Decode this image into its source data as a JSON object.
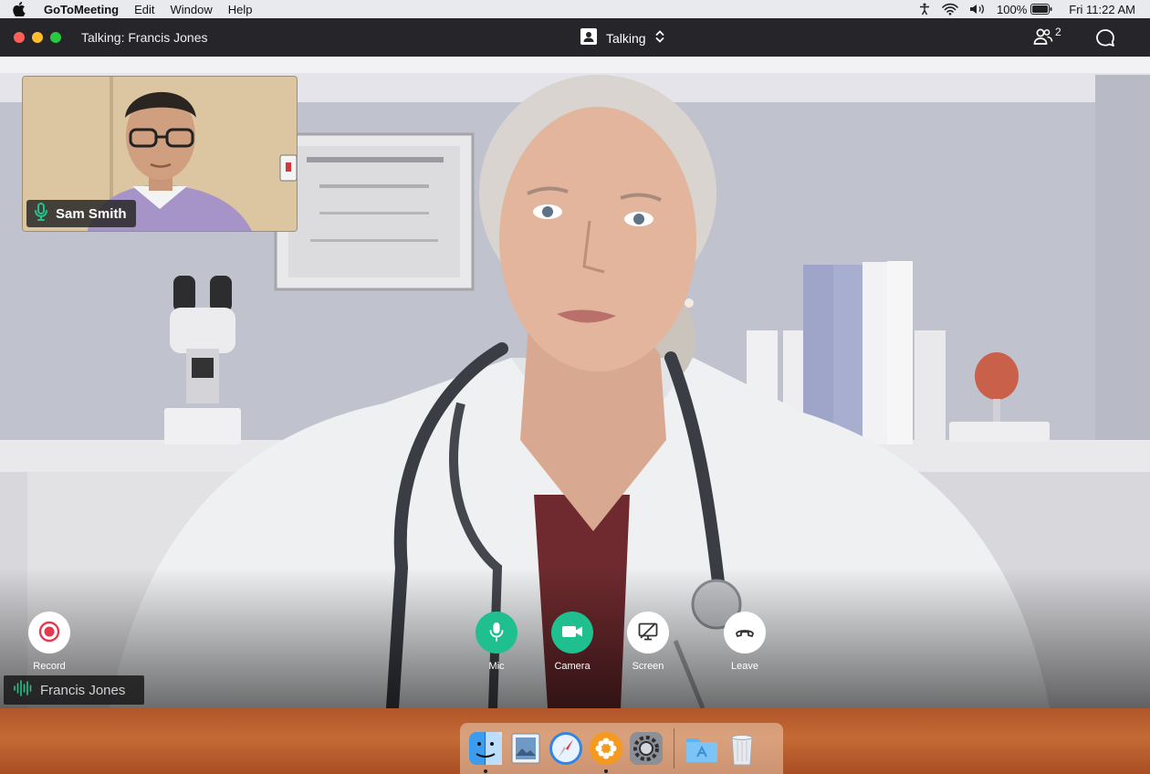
{
  "menubar": {
    "app_name": "GoToMeeting",
    "items": [
      "Edit",
      "Window",
      "Help"
    ],
    "battery": "100%",
    "clock": "Fri 11:22 AM"
  },
  "window": {
    "title": "Talking: Francis Jones",
    "view_mode": "Talking",
    "participant_count": "2"
  },
  "thumbnail": {
    "name": "Sam Smith"
  },
  "controls": {
    "record": "Record",
    "mic": "Mic",
    "camera": "Camera",
    "screen": "Screen",
    "leave": "Leave"
  },
  "speaker": {
    "name": "Francis Jones"
  },
  "colors": {
    "accent_green": "#1fbf8f",
    "record_red": "#e8384f",
    "titlebar": "#26262a"
  },
  "dock": {
    "icons": [
      "finder-icon",
      "preview-icon",
      "safari-icon",
      "gotomeeting-icon",
      "system-preferences-icon",
      "app-store-folder-icon",
      "trash-icon"
    ]
  }
}
